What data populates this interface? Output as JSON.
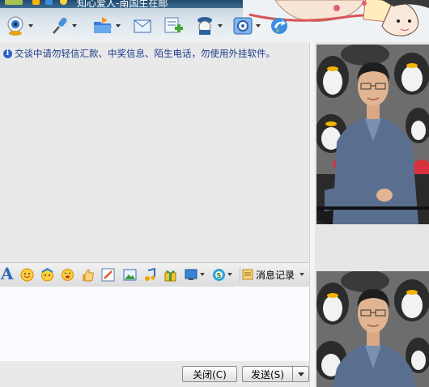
{
  "window": {
    "title": "知心爱人-南国生在邮"
  },
  "colors": {
    "toolbar_bg": "#dbe4ec",
    "notice_text": "#1c3a8c",
    "input_bg": "#fafbfe",
    "pane_bg": "#e9e9e9"
  },
  "toolbar": {
    "icons": [
      "webcam-icon",
      "microphone-icon",
      "send-file-icon",
      "email-icon",
      "add-note-icon",
      "qq-profile-icon",
      "settings-icon",
      "share-icon"
    ]
  },
  "chat": {
    "notice": "交谈中请勿轻信汇款、中奖信息、陌生电话，勿使用外挂软件。"
  },
  "input_toolbar": {
    "font_label": "A",
    "history_label": "消息记录",
    "icons": [
      "font-icon",
      "emoji-icon",
      "magic-face-icon",
      "shake-icon",
      "thumb-icon",
      "doodle-icon",
      "image-icon",
      "music-icon",
      "gift-icon",
      "screenshot-icon",
      "currency-icon",
      "history-icon"
    ]
  },
  "buttons": {
    "close": "关闭(C)",
    "send": "发送(S)"
  },
  "photos": {
    "top": "contact-photo",
    "bottom": "self-photo"
  }
}
